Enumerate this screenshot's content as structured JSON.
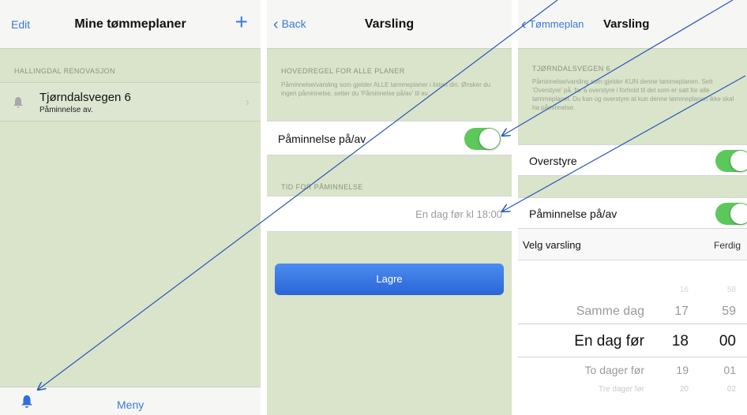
{
  "panel1": {
    "nav_left": "Edit",
    "title": "Mine tømmeplaner",
    "nav_right": "+",
    "section": "HALLINGDAL RENOVASJON",
    "item_title": "Tjørndalsvegen 6",
    "item_subtitle": "Påminnelse av.",
    "tab_label": "Meny"
  },
  "panel2": {
    "back_label": "Back",
    "title": "Varsling",
    "section": "HOVEDREGEL FOR ALLE PLANER",
    "footnote": "Påminnelse/varsling som gjelder ALLE tømmeplaner i listen din. Ønsker du ingen påminnelse, setter du 'Påminnelse på/av' til av.",
    "toggle_label": "Påminnelse på/av",
    "section2": "TID FOR PÅMINNELSE",
    "time_value": "En dag før kl 18:00",
    "save_label": "Lagre"
  },
  "panel3": {
    "back_label": "Tømmeplan",
    "title": "Varsling",
    "section": "TJØRNDALSVEGEN 6",
    "footnote": "Påminnelse/varsling som gjelder KUN denne tømmeplanen. Sett 'Overstyre' på, for å overstyre i forhold til det som er satt for alle tømmeplaner. Du kan og overstyre at kun denne tømmeplanen ikke skal ha påminnelse.",
    "override_label": "Overstyre",
    "toggle_label": "Påminnelse på/av",
    "picker_title": "Velg varsling",
    "picker_done": "Ferdig",
    "days": [
      "Samme dag",
      "En dag før",
      "To dager før",
      "Tre dager før"
    ],
    "hours": [
      "16",
      "17",
      "18",
      "19",
      "20"
    ],
    "minutes": [
      "58",
      "59",
      "00",
      "01",
      "02"
    ]
  },
  "colors": {
    "accent": "#3a7bd5",
    "toggle_on": "#5cc85b",
    "background": "#d9e4cb",
    "annotation": "#2a57b8"
  },
  "icons": {
    "bell_row": "bell-icon",
    "bell_tab": "bell-icon",
    "back": "chevron-left-icon",
    "add": "plus-icon",
    "disclosure": "chevron-right-icon"
  }
}
